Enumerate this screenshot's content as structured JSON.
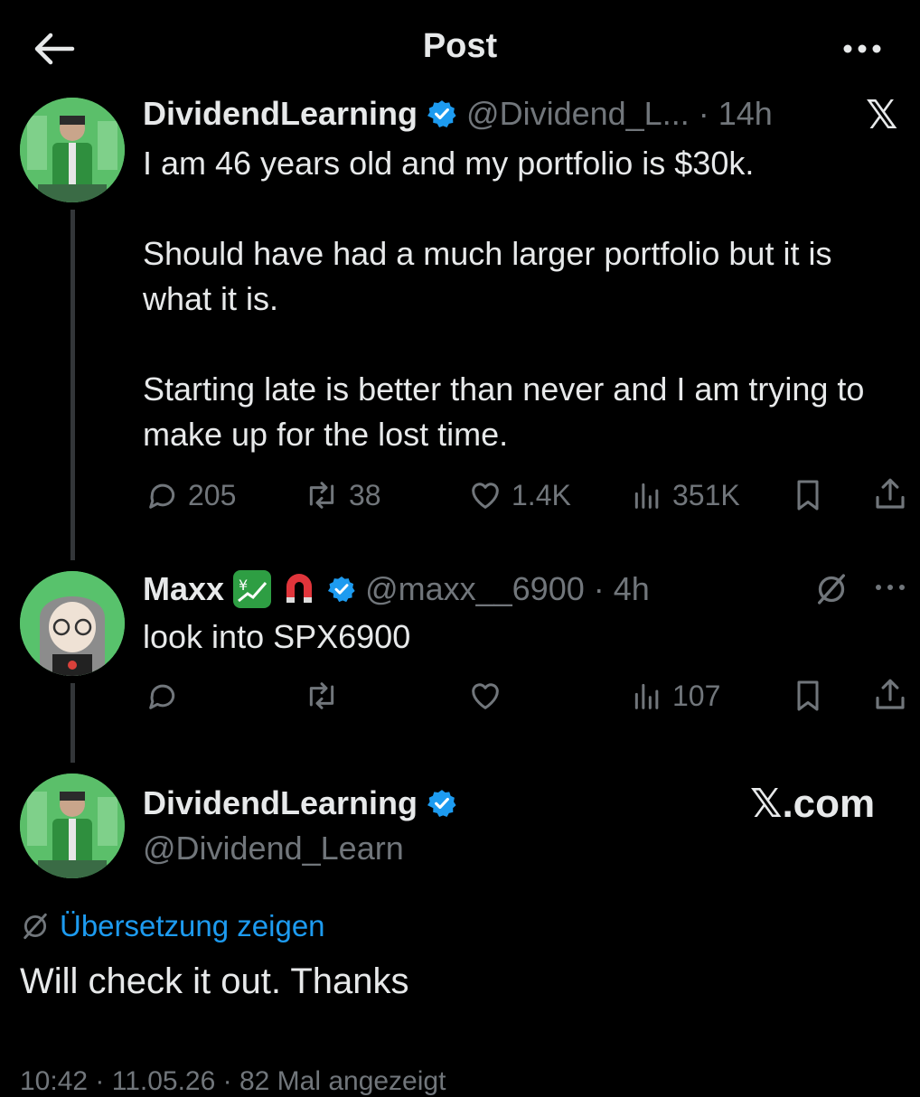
{
  "header": {
    "title": "Post",
    "back_icon": "arrow-left-icon",
    "more_icon": "more-horizontal-icon"
  },
  "post1": {
    "name": "DividendLearning",
    "handle": "@Dividend_L...",
    "separator": "·",
    "time": "14h",
    "text": "I am 46 years old and my portfolio is $30k.\n\nShould have had a much larger portfolio but it is what it is.\n\nStarting late is better than never and I am trying to make up for the lost time.",
    "platform_logo": "𝕏",
    "stats": {
      "replies": "205",
      "reposts": "38",
      "likes": "1.4K",
      "views": "351K"
    }
  },
  "post2": {
    "name": "Maxx",
    "emojis": [
      "chart-yen-emoji",
      "magnet-emoji"
    ],
    "handle": "@maxx__6900",
    "separator": "·",
    "time": "4h",
    "text": "look into SPX6900",
    "stats": {
      "views": "107"
    }
  },
  "post3": {
    "name": "DividendLearning",
    "handle": "@Dividend_Learn",
    "site": "𝕏.com",
    "translate_label": "Übersetzung zeigen",
    "text": "Will check it out. Thanks",
    "footer": "10:42 · 11.05.26 · 82 Mal angezeigt"
  },
  "colors": {
    "background": "#000000",
    "text": "#e7e9ea",
    "muted": "#71767b",
    "accent": "#1d9bf0",
    "verified": "#1d9bf0"
  }
}
